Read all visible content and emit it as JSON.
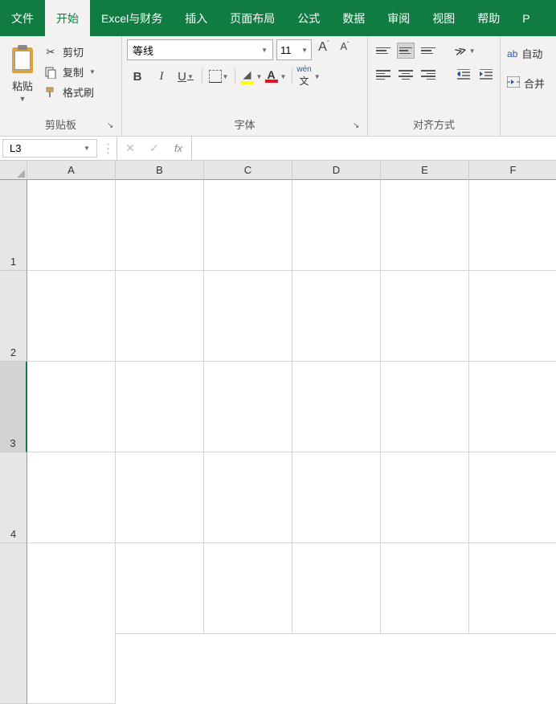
{
  "menu": {
    "file": "文件",
    "home": "开始",
    "excel_finance": "Excel与财务",
    "insert": "插入",
    "layout": "页面布局",
    "formula": "公式",
    "data": "数据",
    "review": "审阅",
    "view": "视图",
    "help": "帮助",
    "p": "P"
  },
  "clipboard": {
    "paste": "粘贴",
    "cut": "剪切",
    "copy": "复制",
    "format_painter": "格式刷",
    "group_label": "剪贴板"
  },
  "font": {
    "name": "等线",
    "size": "11",
    "group_label": "字体",
    "bold": "B",
    "italic": "I",
    "underline": "U",
    "fontcolor_a": "A",
    "wen": "wén",
    "wen_sub": "文",
    "grow_big": "A",
    "grow_sup": "^",
    "shrink_big": "A",
    "shrink_sup": "ˇ"
  },
  "align": {
    "group_label": "对齐方式",
    "auto_wrap": "自动",
    "merge": "合并"
  },
  "fxbar": {
    "name_ref": "L3",
    "cancel": "✕",
    "enter": "✓",
    "fx": "fx",
    "value": ""
  },
  "columns": [
    "A",
    "B",
    "C",
    "D",
    "E",
    "F"
  ],
  "rows": [
    "1",
    "2",
    "3",
    "4"
  ],
  "selected_row_index": 2
}
